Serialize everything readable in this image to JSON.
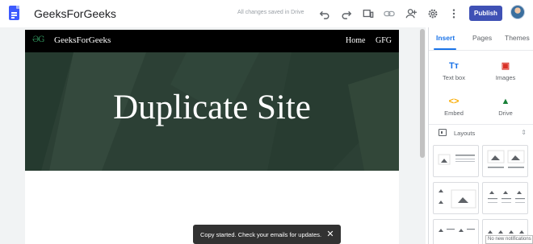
{
  "topbar": {
    "app_icon": "google-sites-icon",
    "site_name": "GeeksForGeeks",
    "save_status": "All changes saved in Drive",
    "icons": [
      "undo-icon",
      "redo-icon",
      "preview-icon",
      "link-icon",
      "share-icon",
      "settings-icon",
      "more-vert-icon"
    ],
    "publish_label": "Publish",
    "accent_color": "#3f51b5"
  },
  "site": {
    "logo_text": "ƏG",
    "title": "GeeksForGeeks",
    "nav": [
      "Home",
      "GFG"
    ],
    "hero_title": "Duplicate Site"
  },
  "toast": {
    "message": "Copy started. Check your emails for updates.",
    "close_icon": "close-icon"
  },
  "panel": {
    "tabs": [
      "Insert",
      "Pages",
      "Themes"
    ],
    "active_tab": "Insert",
    "tools": [
      {
        "label": "Text box",
        "icon": "text-box-icon",
        "glyph": "Tт",
        "color": "#1a73e8"
      },
      {
        "label": "Images",
        "icon": "image-icon",
        "glyph": "▣",
        "color": "#d93025"
      },
      {
        "label": "Embed",
        "icon": "embed-icon",
        "glyph": "<>",
        "color": "#f9ab00"
      },
      {
        "label": "Drive",
        "icon": "drive-icon",
        "glyph": "▲",
        "color": "#188038"
      }
    ],
    "layouts_label": "Layouts",
    "notification": "No new notifications"
  }
}
